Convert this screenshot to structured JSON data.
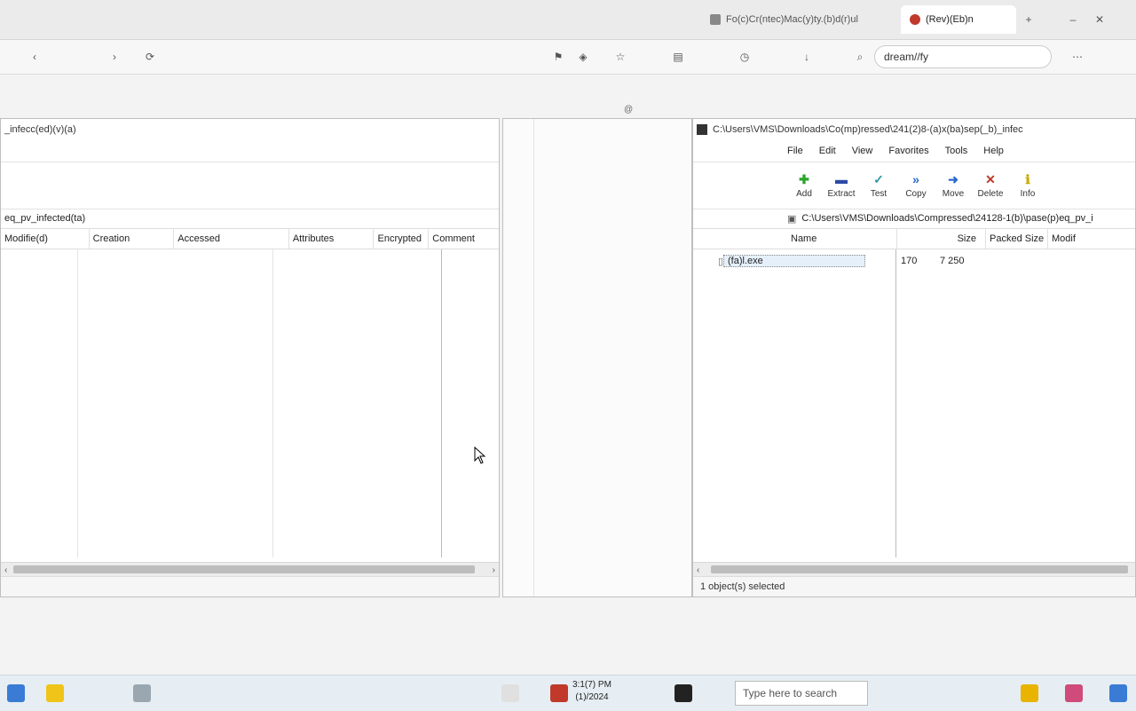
{
  "browser": {
    "tabs": [
      {
        "label": "Fo(c)Cr(ntec)Mac(y)ty.(b)d(r)ul",
        "active": false
      },
      {
        "label": "(Rev)(Eb)n",
        "active": true
      }
    ],
    "address": "dream//fy"
  },
  "page": {
    "zoom_indicator": "@"
  },
  "window_left": {
    "title": "_infecc(ed)(v)(a)",
    "path": "eq_pv_infected(ta)",
    "columns": [
      "Modifie(d)",
      "Creation",
      "Accessed",
      "Attributes",
      "Encrypted",
      "Comment"
    ],
    "status": ""
  },
  "window_right": {
    "title": "C:\\Users\\VMS\\Downloads\\Co(mp)ressed\\241(2)8-(a)x(ba)sep(_b)_infec",
    "menu": [
      "File",
      "Edit",
      "View",
      "Favorites",
      "Tools",
      "Help"
    ],
    "tools": [
      {
        "label": "Add",
        "glyph": "+",
        "color": "#2aa52a"
      },
      {
        "label": "Extract",
        "glyph": "−",
        "color": "#2a4aa5"
      },
      {
        "label": "Test",
        "glyph": "✓",
        "color": "#2a9aa5"
      },
      {
        "label": "Copy",
        "glyph": "»",
        "color": "#2a6ad0"
      },
      {
        "label": "Move",
        "glyph": "→",
        "color": "#2a6ad0"
      },
      {
        "label": "Delete",
        "glyph": "✕",
        "color": "#c0392b"
      },
      {
        "label": "Info",
        "glyph": "i",
        "color": "#c9a800"
      }
    ],
    "path": "C:\\Users\\VMS\\Downloads\\Compressed\\24128-1(b)\\pase(p)eq_pv_i",
    "columns": [
      "Name",
      "Size",
      "Packed Size",
      "Modif"
    ],
    "files": [
      {
        "name": "(fa)l.exe",
        "size": "170",
        "packed": "7 250"
      }
    ],
    "status": "1 object(s) selected"
  },
  "taskbar": {
    "search_placeholder": "Type here to search",
    "clock_time": "3:1(7) PM",
    "clock_date": "(1)/2024"
  }
}
